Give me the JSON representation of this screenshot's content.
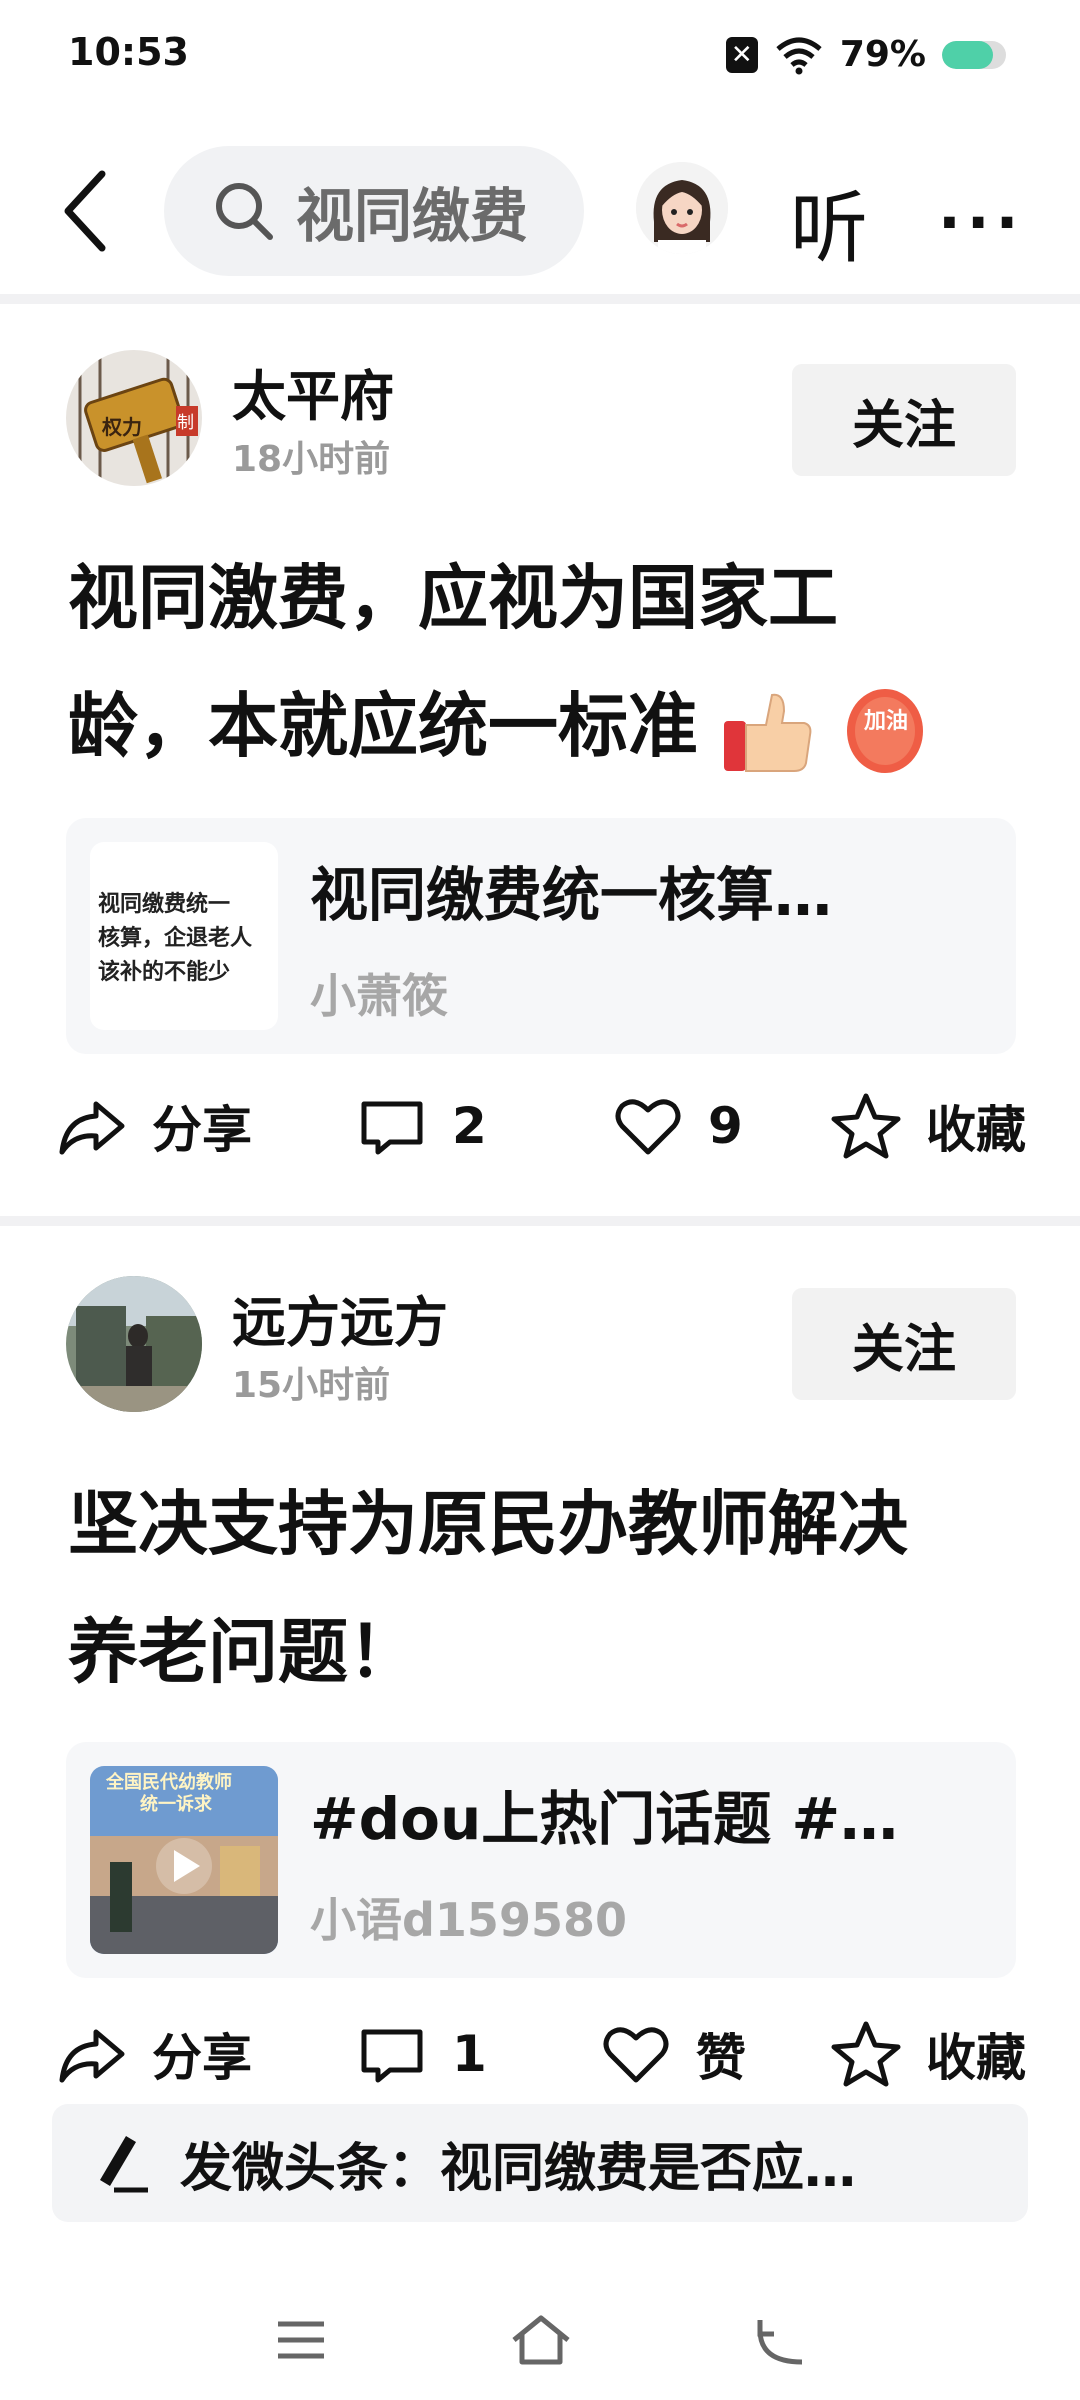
{
  "status_bar": {
    "time": "10:53",
    "battery_text": "79%",
    "battery_level": 0.79,
    "accent": "#4fd0a8"
  },
  "top_nav": {
    "search_text": "视同缴费",
    "listen_label": "听",
    "more_label": "···"
  },
  "posts": [
    {
      "author": "太平府",
      "time": "18小时前",
      "follow_label": "关注",
      "text_line1": "视同激费，应视为国家工",
      "text_line2": "龄，本就应统一标准",
      "emoji_jiayou": "加油",
      "ref": {
        "title": "视同缴费统一核算…",
        "author": "小萧筱",
        "thumb_lines": [
          "视同缴费统一",
          "核算，企退老人",
          "该补的不能少"
        ]
      },
      "actions": {
        "share": "分享",
        "comments": "2",
        "likes": "9",
        "favorite": "收藏"
      },
      "avatar_text": [
        "权力",
        "制"
      ]
    },
    {
      "author": "远方远方",
      "time": "15小时前",
      "follow_label": "关注",
      "text_line1": "坚决支持为原民办教师解决",
      "text_line2": "养老问题！",
      "ref": {
        "title": "#dou上热门话题 #…",
        "author": "小语d159580",
        "thumb_lines": [
          "全国民代幼教师",
          "统一诉求"
        ]
      },
      "actions": {
        "share": "分享",
        "comments": "1",
        "likes": "赞",
        "favorite": "收藏"
      }
    }
  ],
  "composer": {
    "label": "发微头条：视同缴费是否应…"
  }
}
